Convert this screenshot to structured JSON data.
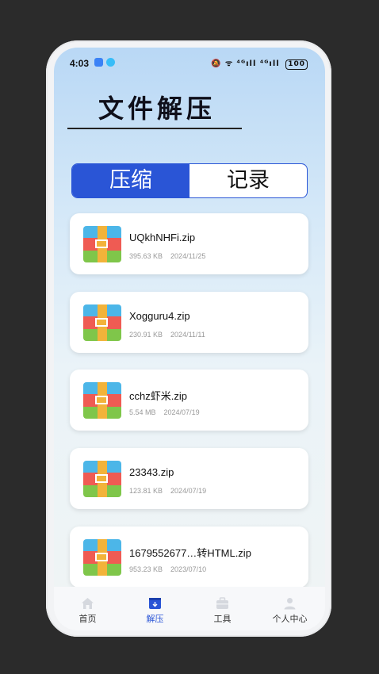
{
  "status_bar": {
    "time": "4:03",
    "right_icons": "🔕 ᯤ ⁴ᴳıll ⁴ᴳıll",
    "battery": "100"
  },
  "page_title": "文件解压",
  "segments": {
    "active": "压缩",
    "inactive": "记录"
  },
  "files": [
    {
      "name": "UQkhNHFi.zip",
      "size": "395.63 KB",
      "date": "2024/11/25"
    },
    {
      "name": "Xogguru4.zip",
      "size": "230.91 KB",
      "date": "2024/11/11"
    },
    {
      "name": "cchz虾米.zip",
      "size": "5.54 MB",
      "date": "2024/07/19"
    },
    {
      "name": "23343.zip",
      "size": "123.81 KB",
      "date": "2024/07/19"
    },
    {
      "name": "1679552677…转HTML.zip",
      "size": "953.23 KB",
      "date": "2023/07/10"
    }
  ],
  "nav": [
    {
      "label": "首页",
      "icon": "home-icon"
    },
    {
      "label": "解压",
      "icon": "unzip-icon"
    },
    {
      "label": "工具",
      "icon": "toolbox-icon"
    },
    {
      "label": "个人中心",
      "icon": "person-icon"
    }
  ],
  "colors": {
    "accent": "#2a55d6",
    "inactive_icon": "#d5d8de"
  }
}
